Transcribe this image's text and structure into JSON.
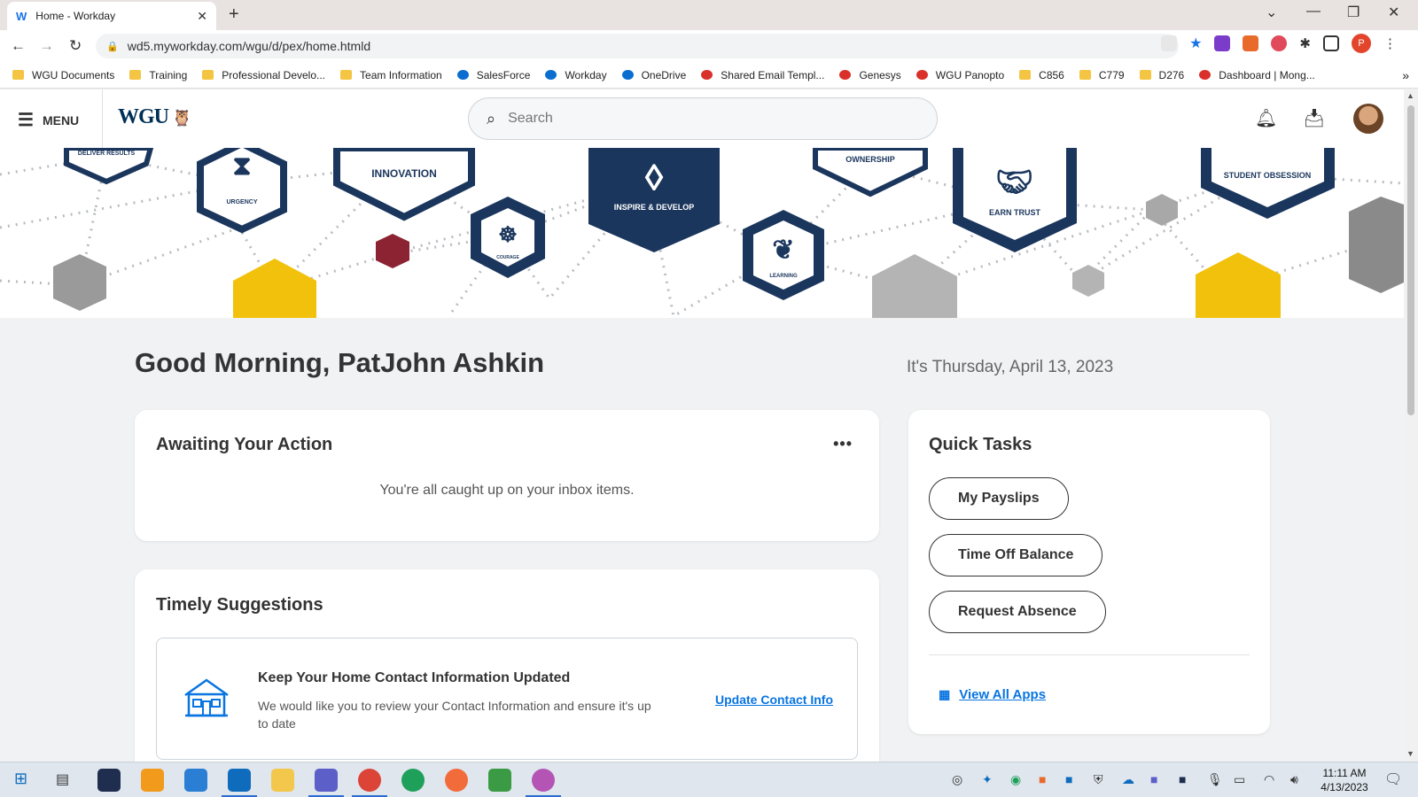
{
  "browser": {
    "tab_title": "Home - Workday",
    "tab_favicon": "W",
    "url": "wd5.myworkday.com/wgu/d/pex/home.htmld",
    "profile_initial": "P",
    "bookmarks": [
      {
        "label": "WGU Documents",
        "icon": "folder"
      },
      {
        "label": "Training",
        "icon": "folder"
      },
      {
        "label": "Professional Develo...",
        "icon": "folder"
      },
      {
        "label": "Team Information",
        "icon": "folder"
      },
      {
        "label": "SalesForce",
        "icon": "cloud"
      },
      {
        "label": "Workday",
        "icon": "workday"
      },
      {
        "label": "OneDrive",
        "icon": "cloud"
      },
      {
        "label": "Shared Email Templ...",
        "icon": "web"
      },
      {
        "label": "Genesys",
        "icon": "web"
      },
      {
        "label": "WGU Panopto",
        "icon": "web"
      },
      {
        "label": "C856",
        "icon": "folder"
      },
      {
        "label": "C779",
        "icon": "folder"
      },
      {
        "label": "D276",
        "icon": "folder"
      },
      {
        "label": "Dashboard | Mong...",
        "icon": "web"
      }
    ]
  },
  "header": {
    "menu_label": "MENU",
    "logo_text": "WGU",
    "search_placeholder": "Search"
  },
  "banner": {
    "badges": [
      "DELIVER RESULTS",
      "URGENCY",
      "INNOVATION",
      "COURAGE",
      "INSPIRE & DEVELOP",
      "LEARNING",
      "OWNERSHIP",
      "EARN TRUST",
      "STUDENT OBSESSION"
    ]
  },
  "main": {
    "greeting": "Good Morning, PatJohn Ashkin",
    "date": "It's Thursday, April 13, 2023",
    "awaiting": {
      "title": "Awaiting Your Action",
      "message": "You're all caught up on your inbox items."
    },
    "timely": {
      "title": "Timely Suggestions",
      "suggestion_title": "Keep Your Home Contact Information Updated",
      "suggestion_body": "We would like you to review your Contact Information and ensure it's up to date",
      "suggestion_link": "Update Contact Info"
    },
    "quick_tasks": {
      "title": "Quick Tasks",
      "buttons": [
        "My Payslips",
        "Time Off Balance",
        "Request Absence"
      ],
      "view_all": "View All Apps"
    }
  },
  "taskbar": {
    "time": "11:11 AM",
    "date": "4/13/2023"
  },
  "colors": {
    "navy": "#1b365d",
    "gold": "#f2c10b",
    "maroon": "#8b2332",
    "link": "#0875e1"
  }
}
